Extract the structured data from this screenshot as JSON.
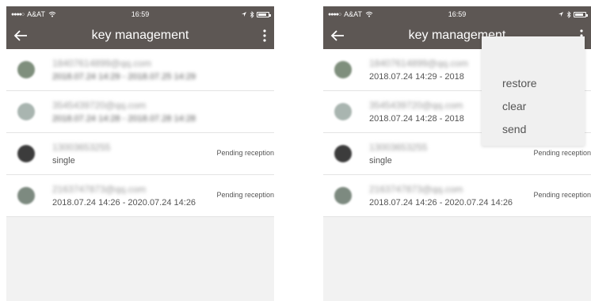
{
  "status_bar": {
    "signal": "●●●●○",
    "carrier": "A&AT",
    "time": "16:59"
  },
  "header": {
    "title": "key management"
  },
  "icons": {
    "back": "arrow-left-icon",
    "more": "more-vertical-icon",
    "wifi": "wifi-icon",
    "location": "location-arrow-icon",
    "bluetooth": "bluetooth-icon",
    "battery": "battery-icon"
  },
  "colors": {
    "header_bg": "#5d5754",
    "background": "#f2f2f2"
  },
  "keys": [
    {
      "account": "18407614899@qq.com",
      "period": "2018.07.24 14:29 - 2018.07.25 14:29",
      "status": "",
      "avatar_color": "#7f8f7d"
    },
    {
      "account": "3545439720@qq.com",
      "period": "2018.07.24 14:28 - 2018.07.28 14:28",
      "status": "",
      "avatar_color": "#a9b5b0"
    },
    {
      "account": "13003653255",
      "period": "single",
      "status": "Pending reception",
      "avatar_color": "#3c3c3c"
    },
    {
      "account": "2163747873@qq.com",
      "period": "2018.07.24 14:26 - 2020.07.24 14:26",
      "status": "Pending reception",
      "avatar_color": "#7d8a80"
    }
  ],
  "right_periods": [
    "2018.07.24 14:29 - 2018",
    "2018.07.24 14:28 - 2018"
  ],
  "menu": {
    "items": [
      "restore",
      "clear",
      "send"
    ]
  }
}
